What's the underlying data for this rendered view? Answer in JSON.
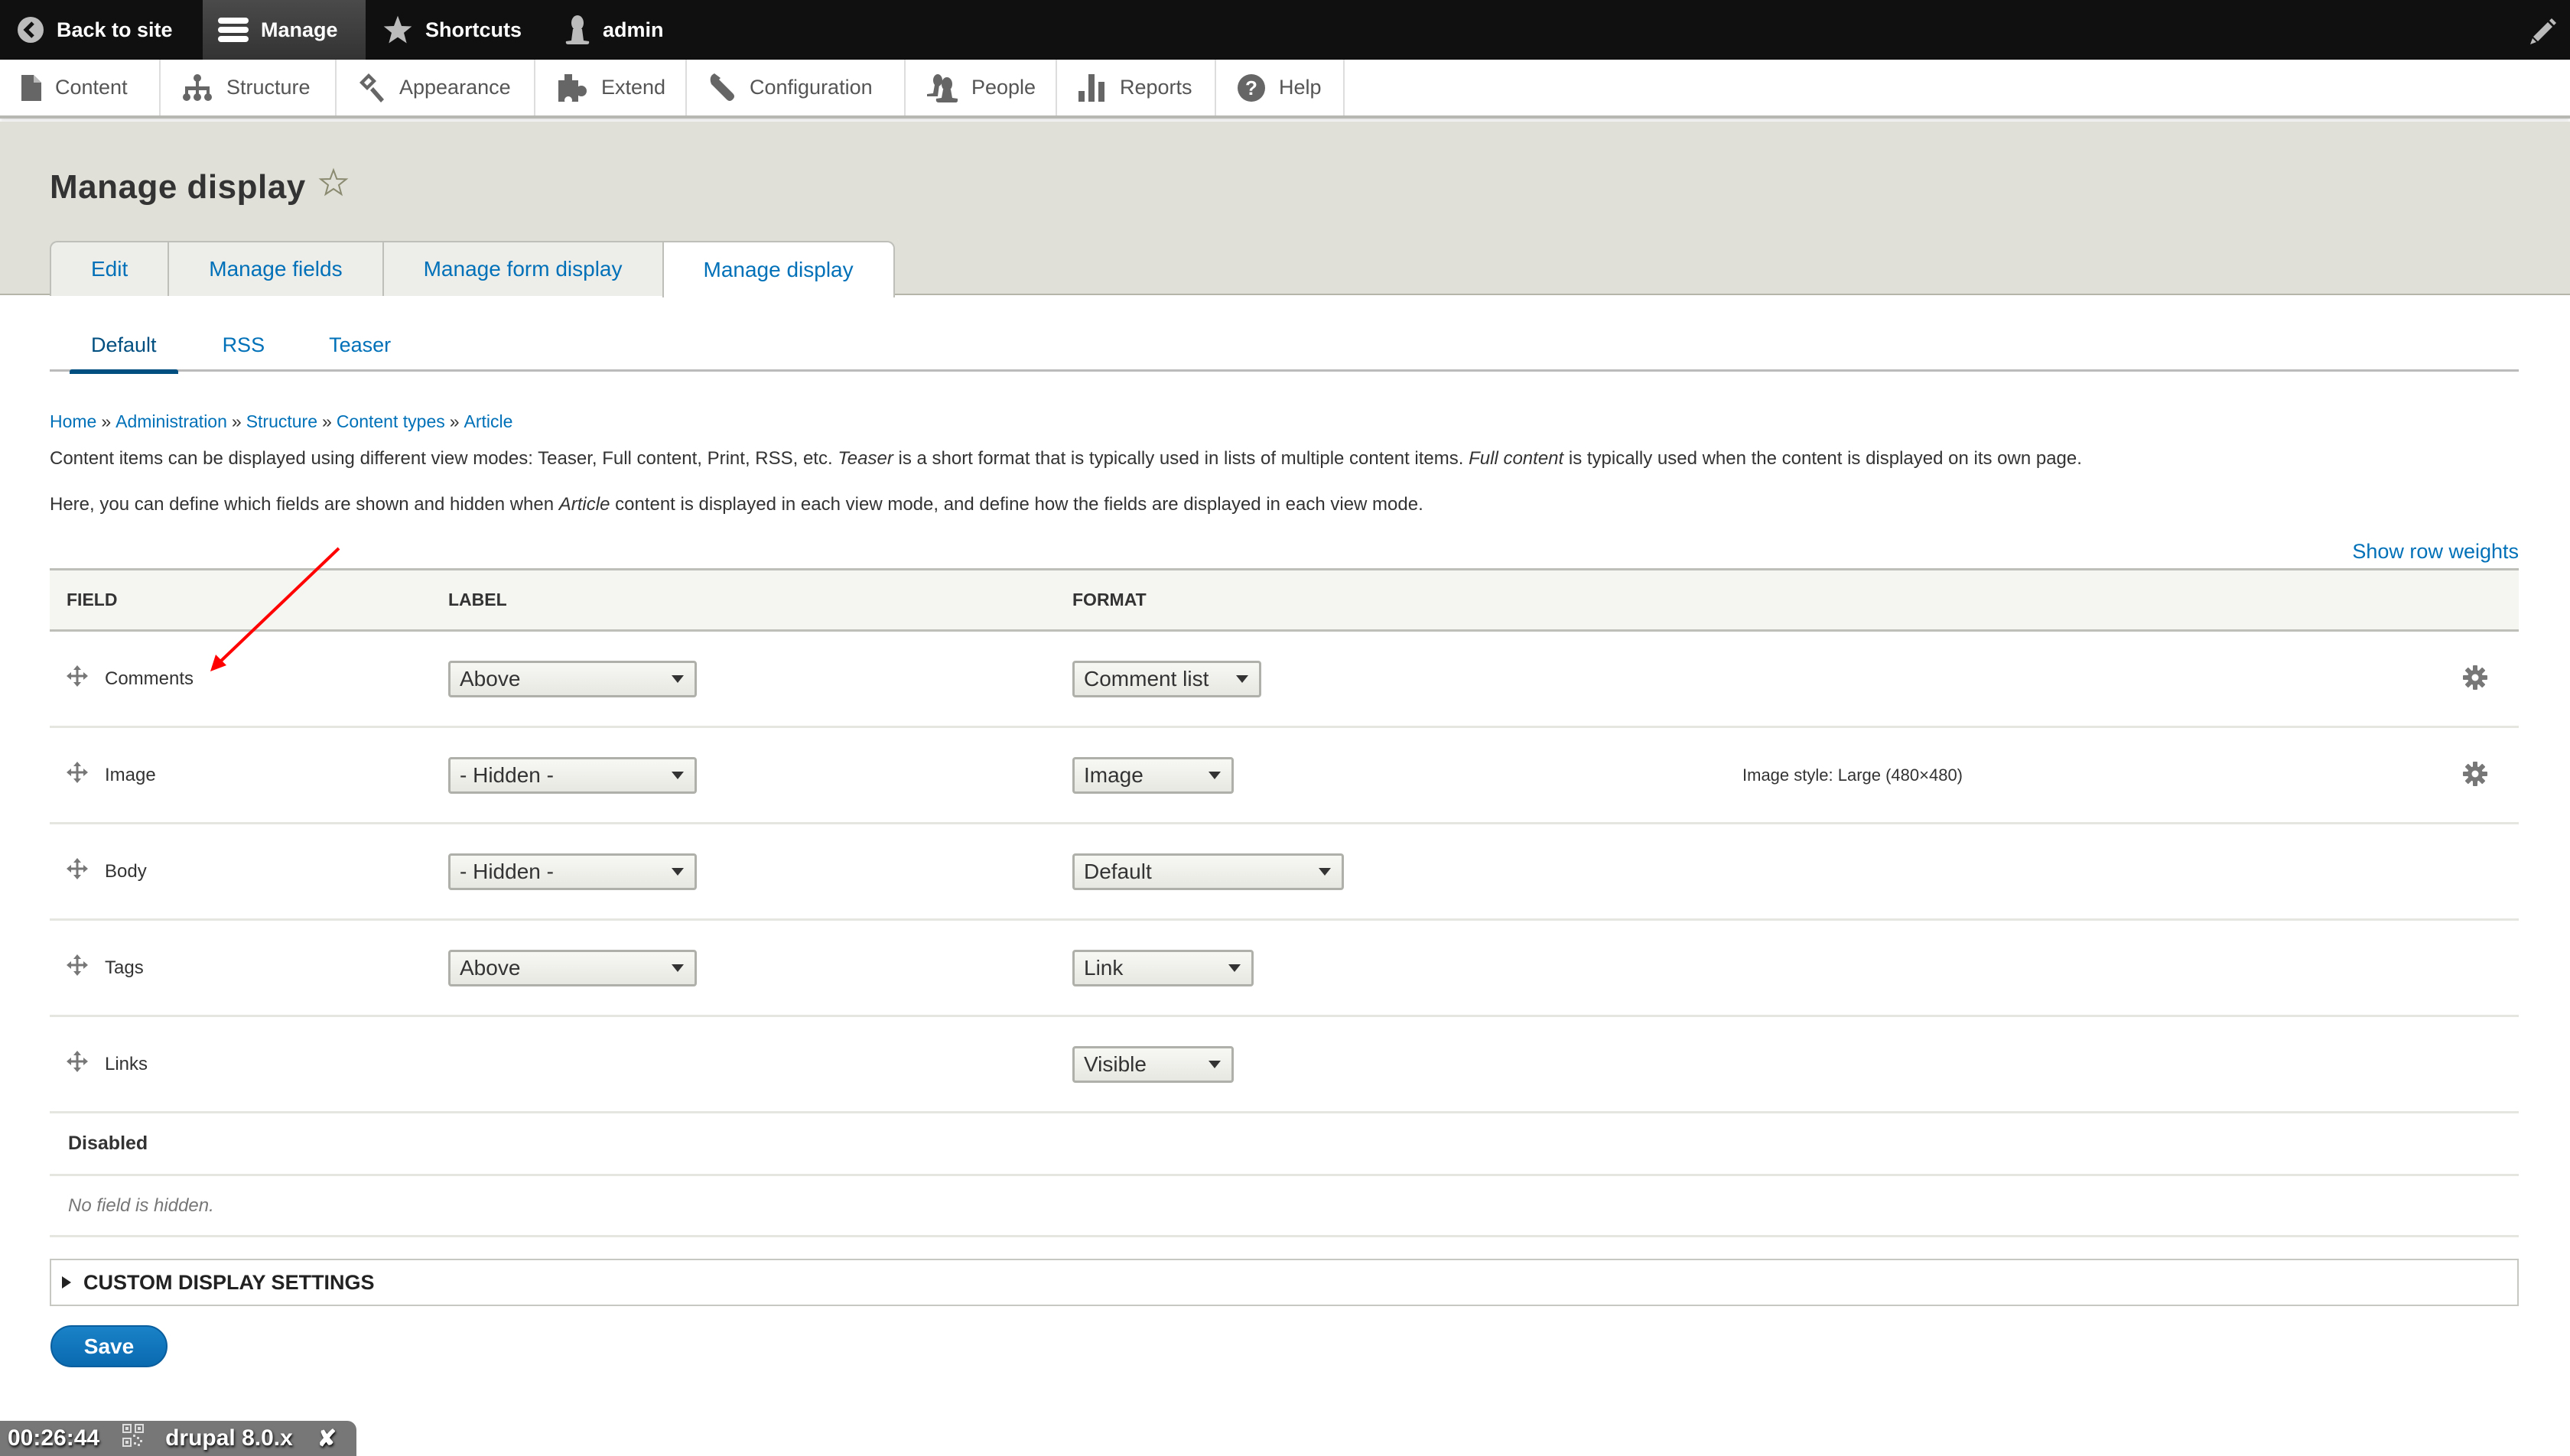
{
  "toolbar": {
    "back_to_site": "Back to site",
    "manage": "Manage",
    "shortcuts": "Shortcuts",
    "user": "admin"
  },
  "tray": {
    "items": [
      {
        "label": "Content",
        "icon": "file-icon"
      },
      {
        "label": "Structure",
        "icon": "sitemap-icon"
      },
      {
        "label": "Appearance",
        "icon": "paintbrush-icon"
      },
      {
        "label": "Extend",
        "icon": "puzzle-icon"
      },
      {
        "label": "Configuration",
        "icon": "wrench-icon"
      },
      {
        "label": "People",
        "icon": "people-icon"
      },
      {
        "label": "Reports",
        "icon": "bar-chart-icon"
      },
      {
        "label": "Help",
        "icon": "help-icon"
      }
    ]
  },
  "page": {
    "title": "Manage display",
    "primary_tabs": [
      "Edit",
      "Manage fields",
      "Manage form display",
      "Manage display"
    ],
    "active_primary_tab": "Manage display",
    "secondary_tabs": [
      "Default",
      "RSS",
      "Teaser"
    ],
    "active_secondary_tab": "Default",
    "breadcrumb": [
      "Home",
      "Administration",
      "Structure",
      "Content types",
      "Article"
    ],
    "breadcrumb_separator": "»",
    "help": {
      "p1_a": "Content items can be displayed using different view modes: Teaser, Full content, Print, RSS, etc. ",
      "p1_em1": "Teaser",
      "p1_b": " is a short format that is typically used in lists of multiple content items. ",
      "p1_em2": "Full content",
      "p1_c": " is typically used when the content is displayed on its own page.",
      "p2_a": "Here, you can define which fields are shown and hidden when ",
      "p2_em": "Article",
      "p2_b": " content is displayed in each view mode, and define how the fields are displayed in each view mode."
    },
    "show_row_weights": "Show row weights"
  },
  "table": {
    "headers": {
      "field": "Field",
      "label": "Label",
      "format": "Format"
    },
    "rows": [
      {
        "field": "Comments",
        "label": "Above",
        "format": "Comment list",
        "summary": "",
        "has_settings": true
      },
      {
        "field": "Image",
        "label": "- Hidden -",
        "format": "Image",
        "summary": "Image style: Large (480×480)",
        "has_settings": true
      },
      {
        "field": "Body",
        "label": "- Hidden -",
        "format": "Default",
        "summary": "",
        "has_settings": false
      },
      {
        "field": "Tags",
        "label": "Above",
        "format": "Link",
        "summary": "",
        "has_settings": false
      },
      {
        "field": "Links",
        "label": "",
        "format": "Visible",
        "summary": "",
        "has_settings": false
      }
    ],
    "disabled_region": "Disabled",
    "disabled_empty": "No field is hidden."
  },
  "custom_display_settings": "Custom display settings",
  "save_label": "Save",
  "overlay": {
    "timer": "00:26:44",
    "label": "drupal 8.0.x",
    "close": "✘"
  },
  "colors": {
    "link": "#0071b8",
    "active_subtab": "#004f80",
    "toolbar": "#101010",
    "header_bg": "#e0e0d8",
    "save_button": "#0a6ab0",
    "annotation": "#ff0000"
  }
}
